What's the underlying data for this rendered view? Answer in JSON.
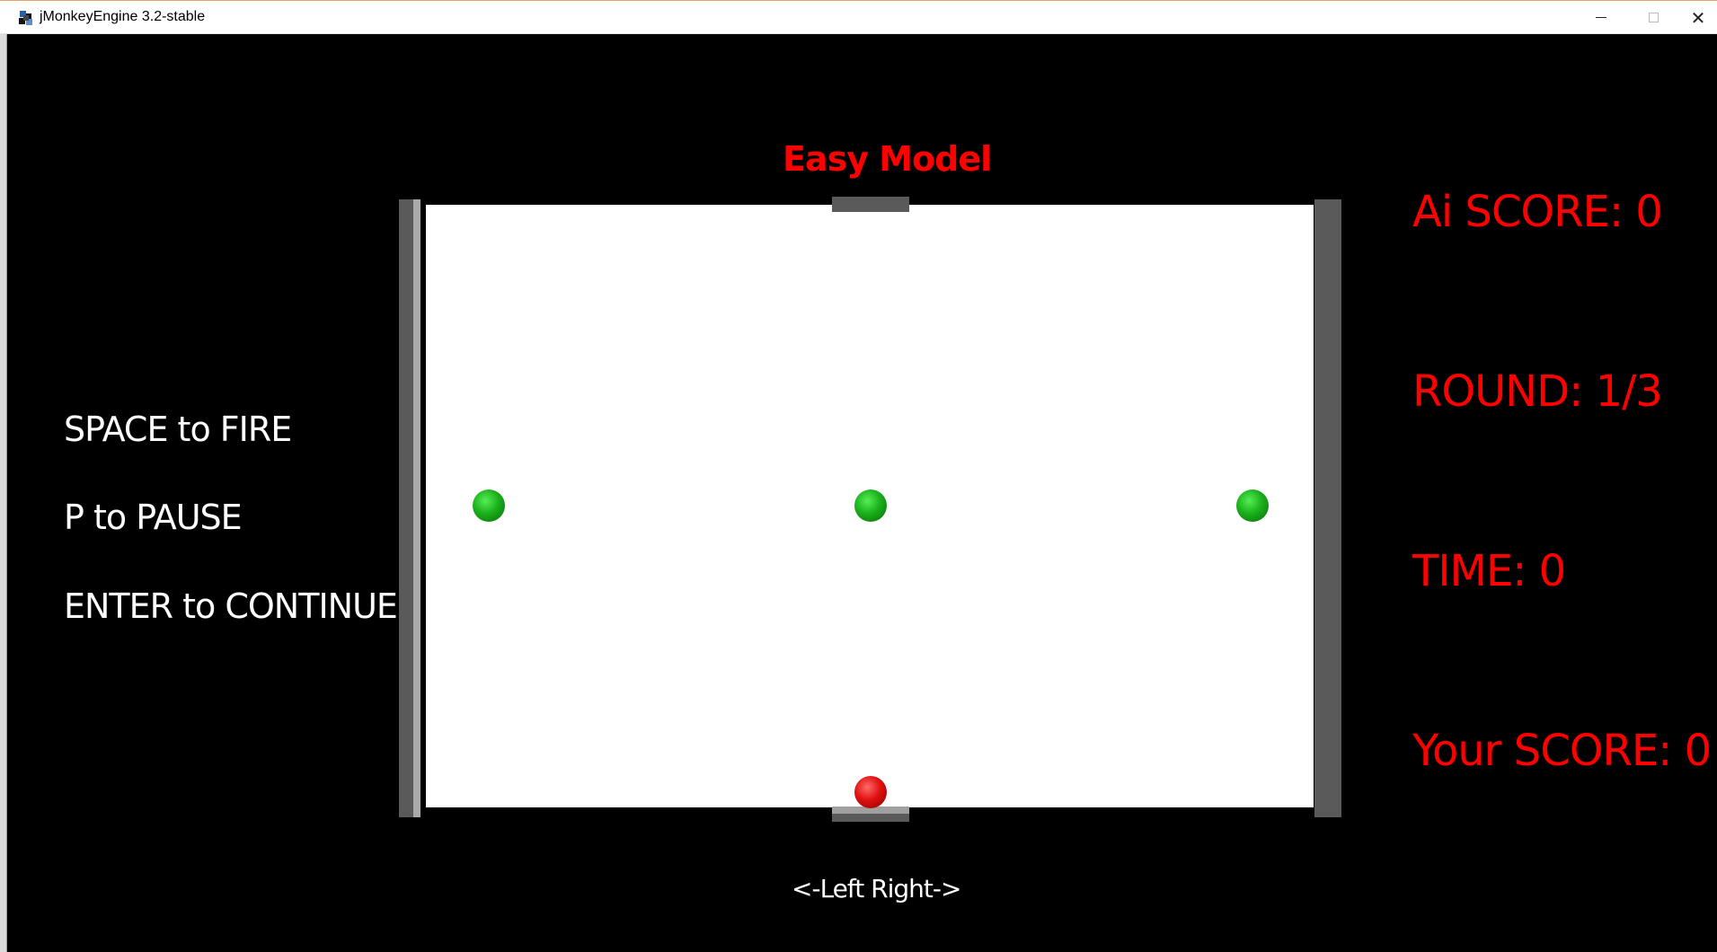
{
  "window": {
    "title": "jMonkeyEngine 3.2-stable",
    "app_icon": "jmonkeyengine-logo-icon",
    "controls": {
      "minimize_icon": "minimize-icon",
      "maximize_icon": "maximize-icon",
      "close_icon": "close-icon",
      "close_glyph": "✕"
    }
  },
  "game": {
    "mode_title": "Easy Model",
    "scoreboard": {
      "ai_score": "Ai SCORE: 0",
      "round": "ROUND: 1/3",
      "time": "TIME: 0",
      "your_score": "Your SCORE: 0"
    },
    "help": {
      "fire": "SPACE to FIRE",
      "pause": "P to PAUSE",
      "continue": "ENTER to CONTINUE"
    },
    "nav_hint": "<-Left   Right->",
    "colors": {
      "hud_red": "#ff0000",
      "hud_white": "#ffffff",
      "field": "#ffffff",
      "wall": "#5a5a5a",
      "target_ball": "#1bb01b",
      "player_ball": "#e01010"
    },
    "targets": [
      "green-ball",
      "green-ball",
      "green-ball"
    ],
    "player_ball": "red-ball"
  }
}
